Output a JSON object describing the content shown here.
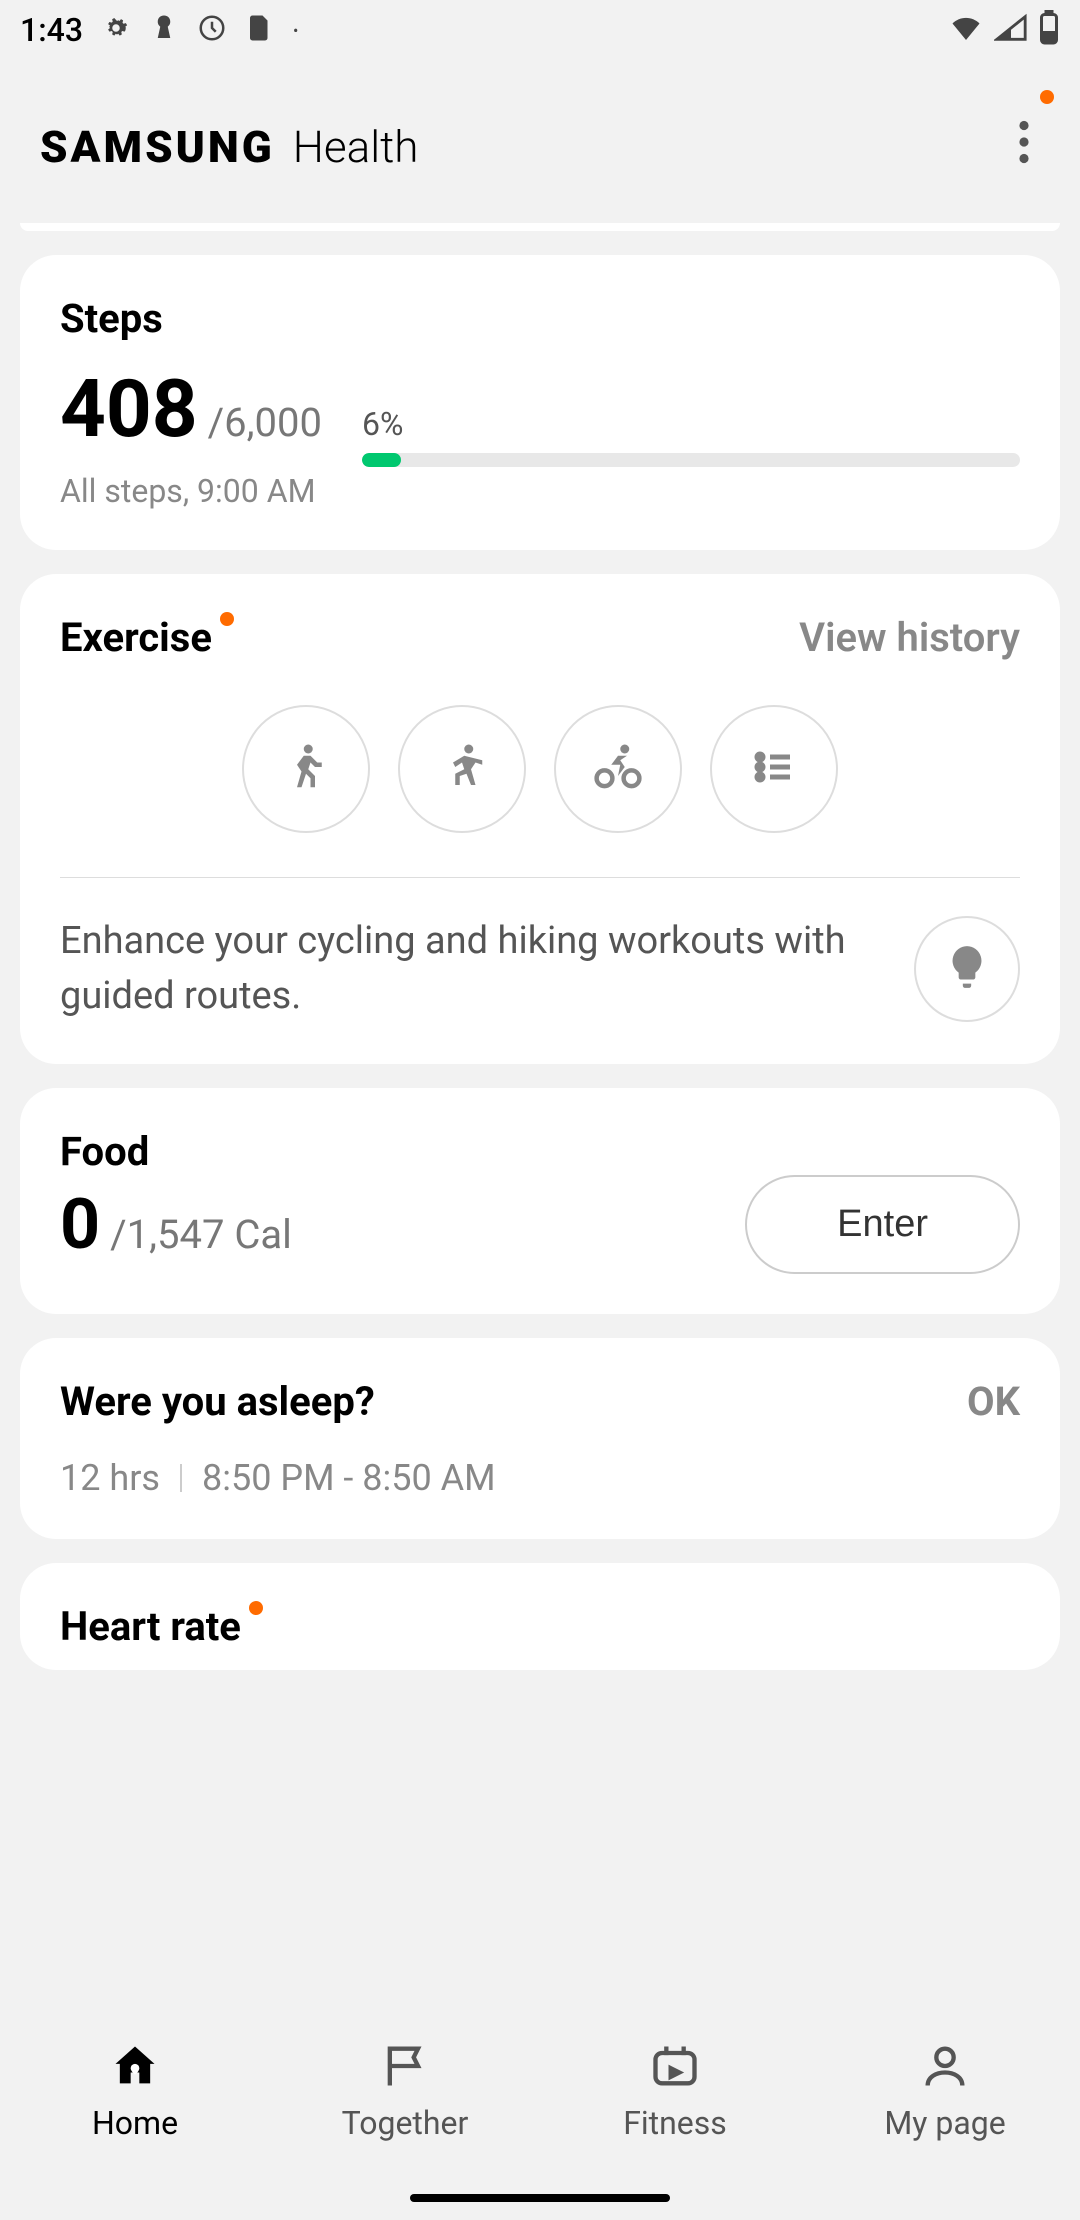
{
  "status": {
    "time": "1:43"
  },
  "header": {
    "brand_samsung": "SAMSUNG",
    "brand_health": "Health"
  },
  "steps": {
    "title": "Steps",
    "count": "408",
    "goal": "/6,000",
    "sub": "All steps, 9:00 AM",
    "percent": "6%",
    "percent_val": 6
  },
  "exercise": {
    "title": "Exercise",
    "view_history": "View history",
    "tip": "Enhance your cycling and hiking workouts with guided routes."
  },
  "food": {
    "title": "Food",
    "count": "0",
    "goal": "/1,547 Cal",
    "enter": "Enter"
  },
  "sleep": {
    "title": "Were you asleep?",
    "ok": "OK",
    "duration": "12 hrs",
    "range": "8:50 PM - 8:50 AM"
  },
  "heart": {
    "title": "Heart rate"
  },
  "nav": {
    "home": "Home",
    "together": "Together",
    "fitness": "Fitness",
    "mypage": "My page"
  },
  "colors": {
    "accent_orange": "#ff6b00",
    "progress_green": "#00c86f"
  }
}
